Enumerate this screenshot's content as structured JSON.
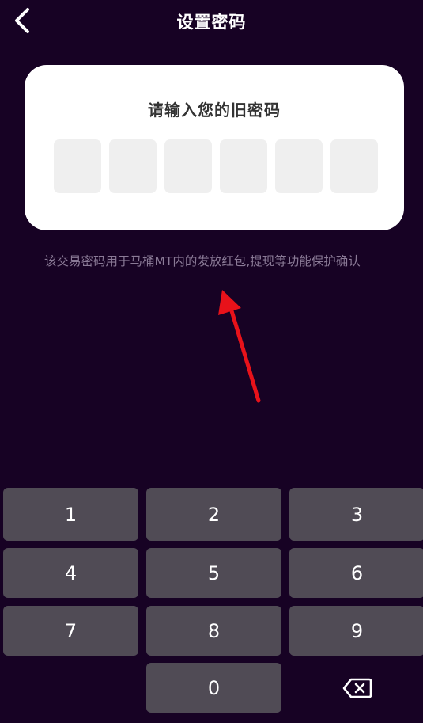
{
  "header": {
    "title": "设置密码",
    "back_icon": "chevron-left-icon"
  },
  "card": {
    "prompt": "请输入您的旧密码",
    "pin_length": 6
  },
  "hint": "该交易密码用于马桶MT内的发放红包,提现等功能保护确认",
  "keypad": {
    "keys": [
      "1",
      "2",
      "3",
      "4",
      "5",
      "6",
      "7",
      "8",
      "9",
      "0"
    ],
    "delete_icon": "backspace-icon"
  },
  "colors": {
    "background": "#170224",
    "card": "#ffffff",
    "pin_box": "#efefef",
    "key": "#504b55",
    "hint_text": "#8a7a96",
    "annotation_arrow": "#e8121a"
  }
}
